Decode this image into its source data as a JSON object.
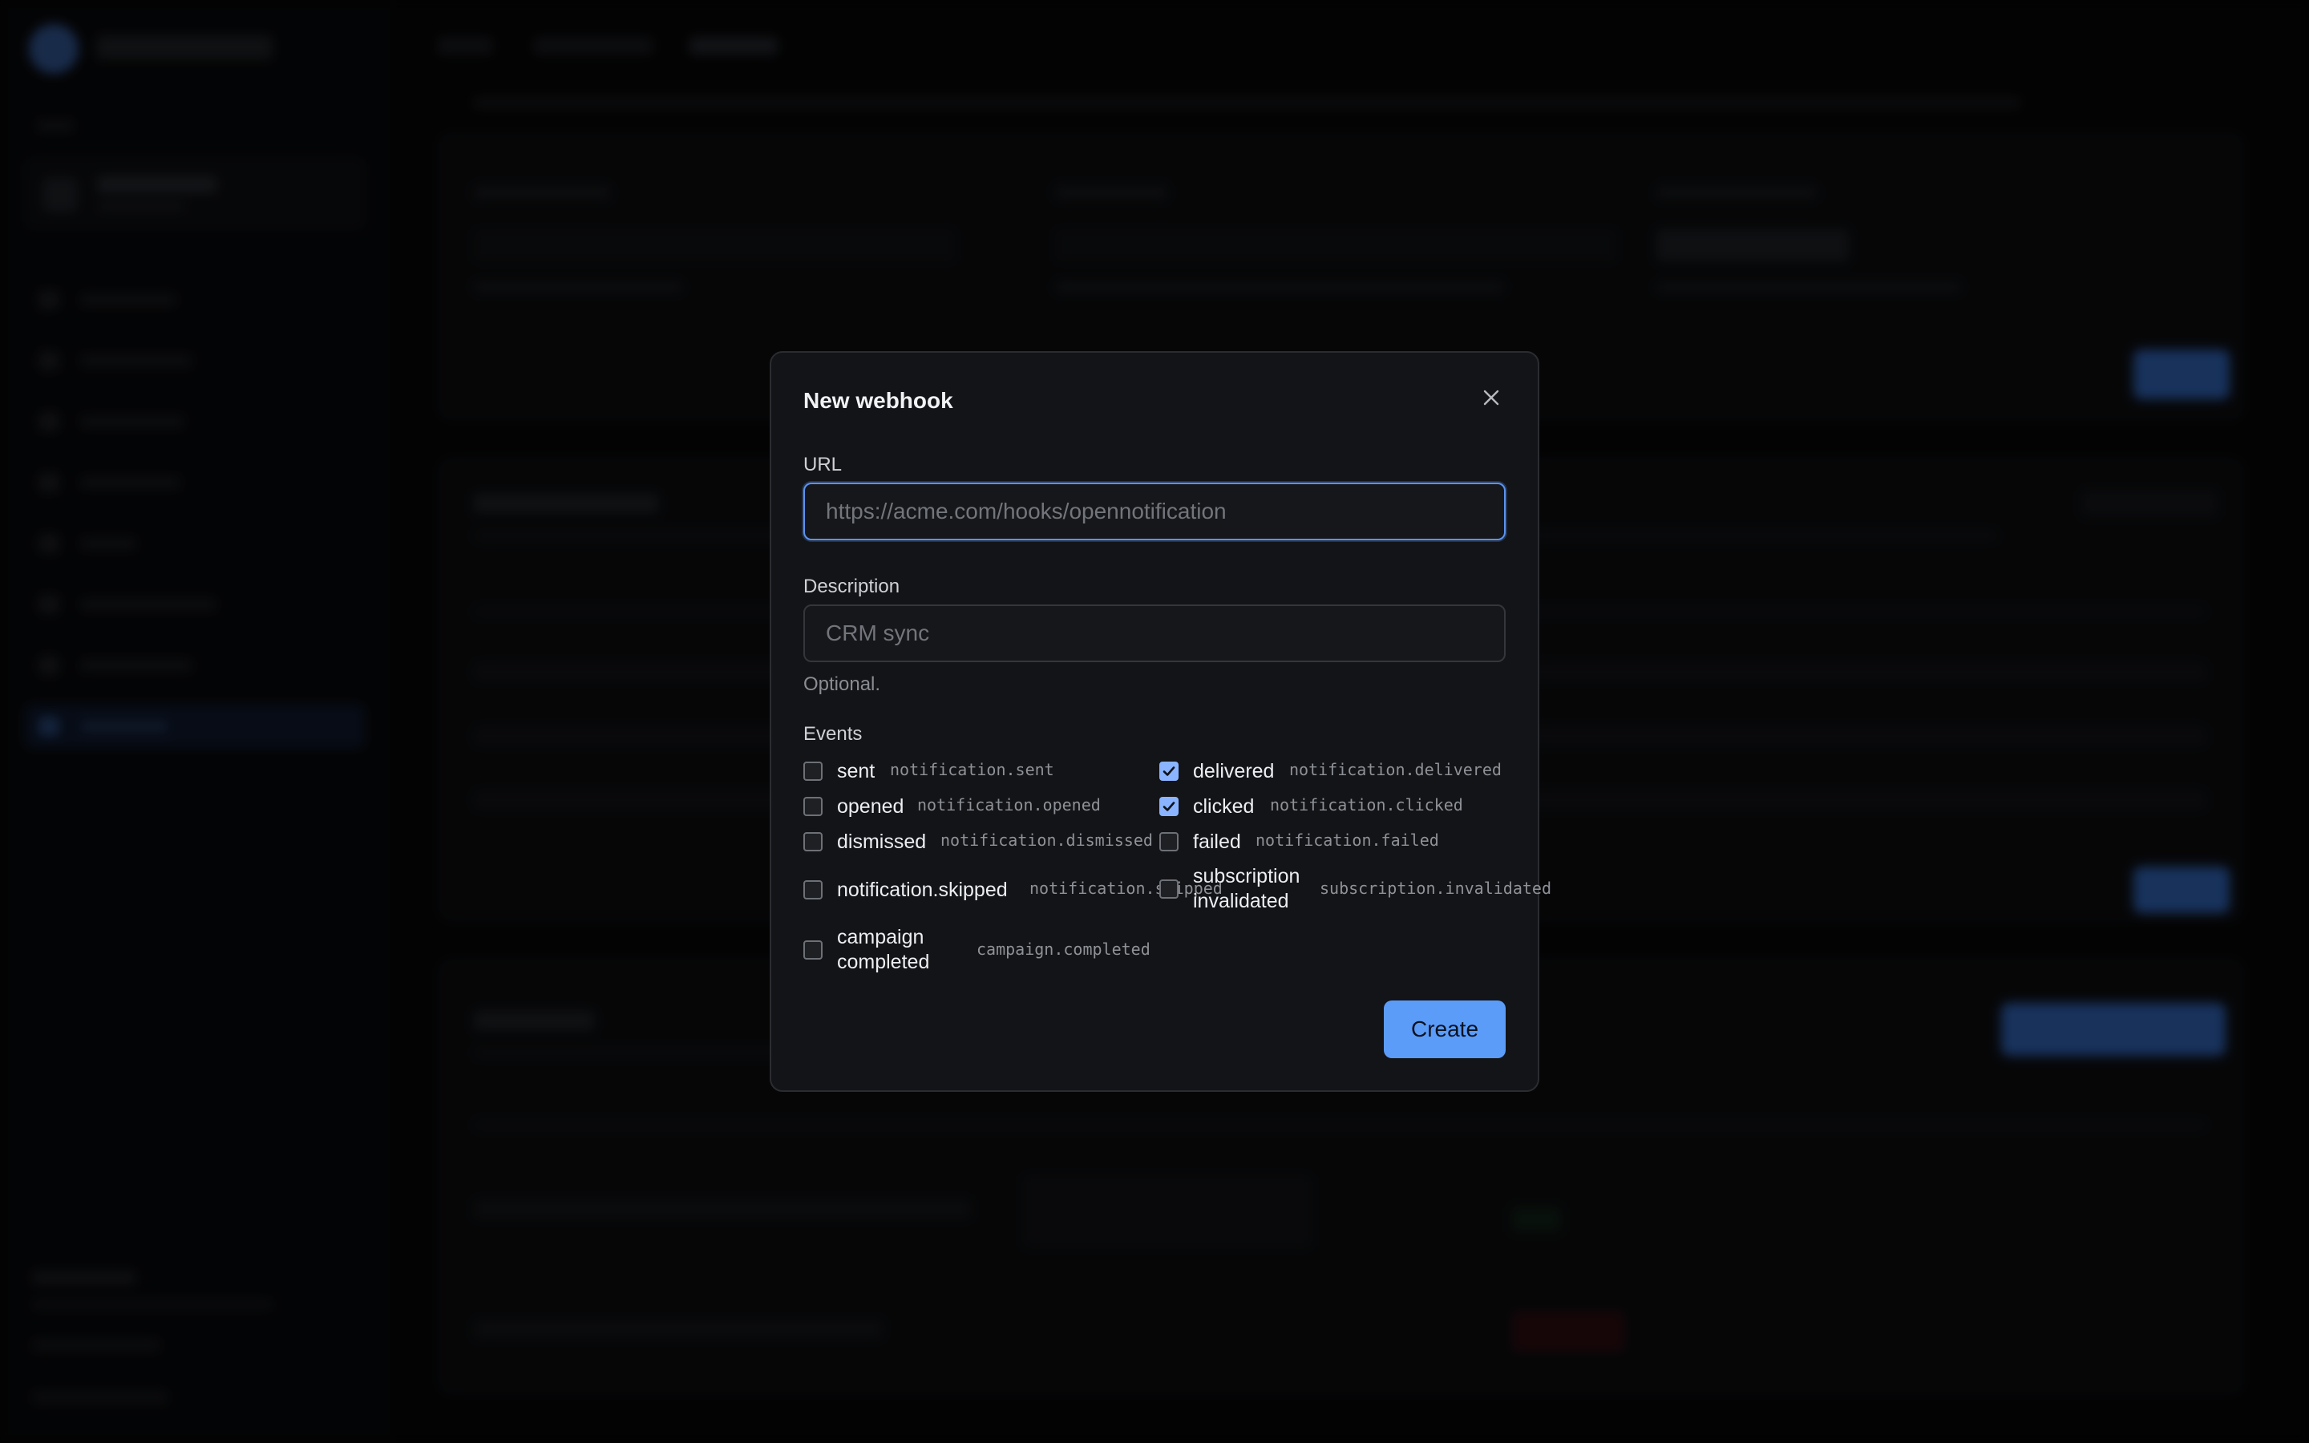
{
  "modal": {
    "title": "New webhook",
    "url_label": "URL",
    "url_placeholder": "https://acme.com/hooks/opennotification",
    "description_label": "Description",
    "description_placeholder": "CRM sync",
    "description_hint": "Optional.",
    "events_label": "Events",
    "create_label": "Create"
  },
  "events": {
    "sent": {
      "label": "sent",
      "code": "notification.sent",
      "checked": false
    },
    "delivered": {
      "label": "delivered",
      "code": "notification.delivered",
      "checked": true
    },
    "opened": {
      "label": "opened",
      "code": "notification.opened",
      "checked": false
    },
    "clicked": {
      "label": "clicked",
      "code": "notification.clicked",
      "checked": true
    },
    "dismissed": {
      "label": "dismissed",
      "code": "notification.dismissed",
      "checked": false
    },
    "failed": {
      "label": "failed",
      "code": "notification.failed",
      "checked": false
    },
    "skipped": {
      "label": "notification.skipped",
      "code": "notification.skipped",
      "checked": false
    },
    "subscription_invalidated": {
      "label_line1": "subscription",
      "label_line2": "invalidated",
      "code": "subscription.invalidated",
      "checked": false
    },
    "campaign_completed": {
      "label_line1": "campaign",
      "label_line2": "completed",
      "code": "campaign.completed",
      "checked": false
    }
  },
  "colors": {
    "accent": "#5b9cf8",
    "checkbox_checked": "#8ab4ff",
    "modal_bg": "#131417",
    "page_bg": "#050506"
  },
  "icons": {
    "close": "close-icon",
    "check": "check-icon"
  }
}
